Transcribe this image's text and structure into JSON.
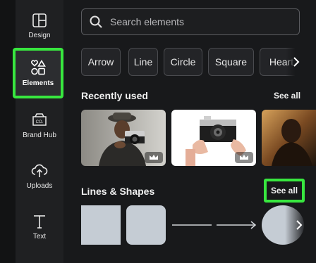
{
  "rail": {
    "items": [
      {
        "label": "Design",
        "icon": "design-layout-icon"
      },
      {
        "label": "Elements",
        "icon": "elements-shapes-icon"
      },
      {
        "label": "Brand Hub",
        "icon": "brand-hub-icon"
      },
      {
        "label": "Uploads",
        "icon": "cloud-upload-icon"
      },
      {
        "label": "Text",
        "icon": "text-t-icon"
      }
    ],
    "active": "Elements"
  },
  "search": {
    "placeholder": "Search elements"
  },
  "chips": [
    "Arrow",
    "Line",
    "Circle",
    "Square",
    "Heart"
  ],
  "recently_used": {
    "heading": "Recently used",
    "see_all": "See all",
    "premium_icon": "crown-icon"
  },
  "lines_shapes": {
    "heading": "Lines & Shapes",
    "see_all": "See all"
  },
  "colors": {
    "highlight": "#38e73f",
    "shape_fill": "#c5ccd4"
  }
}
